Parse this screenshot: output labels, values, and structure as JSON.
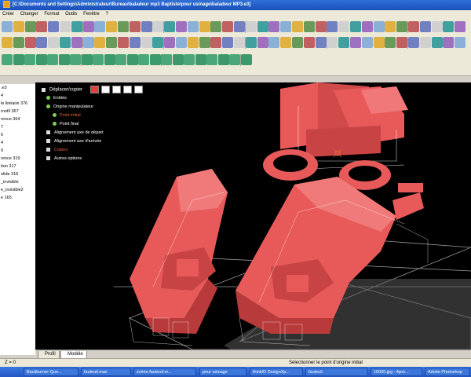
{
  "window": {
    "title": "[C:\\Documents and Settings\\Administrateur\\Bureau\\baladeur mp3 Baptiste\\pour usinage\\baladeur MP3.e3]"
  },
  "menu": [
    "Créer",
    "Changer",
    "Format",
    "Outils",
    "Fenêtre",
    "?"
  ],
  "tree_items": [
    ".e3",
    "4",
    "le linéaire 376",
    "rnofil 367",
    "rence 364",
    "7",
    "6",
    "4",
    "9",
    "rence 319",
    "tion 317",
    "olide 316",
    "_invisible",
    "e_invisible2",
    "e 165"
  ],
  "panel": {
    "title": "Déplacer/copier",
    "rows": [
      {
        "kind": "dot",
        "label": "Entités",
        "indent": 0,
        "color": "#ffffff"
      },
      {
        "kind": "dot",
        "label": "Origine manipulateur",
        "indent": 0,
        "color": "#ffffff"
      },
      {
        "kind": "dot",
        "label": "Point initial",
        "indent": 1,
        "color": "#e8623a"
      },
      {
        "kind": "dot",
        "label": "Point final",
        "indent": 1,
        "color": "#ffffff"
      },
      {
        "kind": "plus",
        "label": "Alignement axe de départ",
        "indent": 0,
        "color": "#ffffff"
      },
      {
        "kind": "plus",
        "label": "Alignement axe d'arrivée",
        "indent": 0,
        "color": "#ffffff"
      },
      {
        "kind": "plus",
        "label": "Copies",
        "indent": 0,
        "color": "#e8623a"
      },
      {
        "kind": "plus",
        "label": "Autres options",
        "indent": 0,
        "color": "#ffffff"
      }
    ]
  },
  "tabs": {
    "profil": "Profil",
    "modele": "Modèle"
  },
  "status": {
    "left": "Z = 0",
    "center": "Sélectionner le point d'origine initial"
  },
  "taskbar": [
    {
      "label": "Backburner Que..."
    },
    {
      "label": "fauteuil.max"
    },
    {
      "label": "scène fauteuil.m..."
    },
    {
      "label": "pour usinage"
    },
    {
      "label": "thinkID DesignXp..."
    },
    {
      "label": "fauteuil"
    },
    {
      "label": "10000.jpg - Aper..."
    },
    {
      "label": "Adobe Photoshop"
    }
  ],
  "colors": {
    "model": "#e85a5a",
    "model_dark": "#b83a3a",
    "viewport": "#000000",
    "accent": "#e8623a"
  }
}
